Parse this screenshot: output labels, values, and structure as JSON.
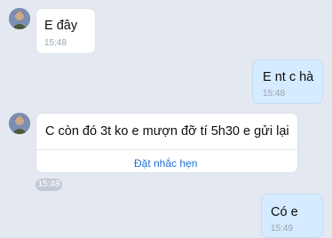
{
  "messages": [
    {
      "direction": "incoming",
      "text": "E đây",
      "time": "15:48"
    },
    {
      "direction": "outgoing",
      "text": "E nt c hà",
      "time": "15:48"
    },
    {
      "direction": "incoming",
      "text": "C còn đó 3t ko e mượn đỡ tí 5h30 e gửi lại",
      "action": "Đặt nhắc hẹn",
      "time": "15:48"
    },
    {
      "direction": "outgoing",
      "text": "Có e",
      "time": "15:49"
    }
  ],
  "icons": {
    "avatar": "contact-avatar-icon"
  },
  "colors": {
    "background": "#e4e8f0",
    "incoming_bubble": "#ffffff",
    "outgoing_bubble": "#d5ebff",
    "link": "#1f72d8"
  }
}
